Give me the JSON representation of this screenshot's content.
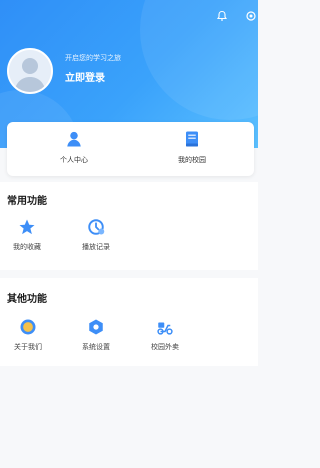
{
  "header": {
    "slogan": "开启您的学习之旅",
    "login_label": "立即登录",
    "gradient_start": "#2f8ff7",
    "gradient_end": "#5bc0ff",
    "top_icons": [
      "notification-bell-icon",
      "settings-icon"
    ]
  },
  "quick_card": {
    "items": [
      {
        "label": "个人中心",
        "icon": "person-icon",
        "color": "#3d8ef7"
      },
      {
        "label": "我的校园",
        "icon": "book-icon",
        "color": "#3d8ef7"
      }
    ]
  },
  "common_functions": {
    "title": "常用功能",
    "items": [
      {
        "label": "我的收藏",
        "icon": "star-icon",
        "color": "#3d8ef7"
      },
      {
        "label": "播放记录",
        "icon": "history-clock-icon",
        "color": "#3d8ef7"
      }
    ]
  },
  "other_functions": {
    "title": "其他功能",
    "items": [
      {
        "label": "关于我们",
        "icon": "about-icon",
        "color": "#f5a623"
      },
      {
        "label": "系统设置",
        "icon": "hexagon-settings-icon",
        "color": "#3d8ef7"
      },
      {
        "label": "校园外卖",
        "icon": "delivery-scooter-icon",
        "color": "#3d8ef7"
      }
    ]
  }
}
